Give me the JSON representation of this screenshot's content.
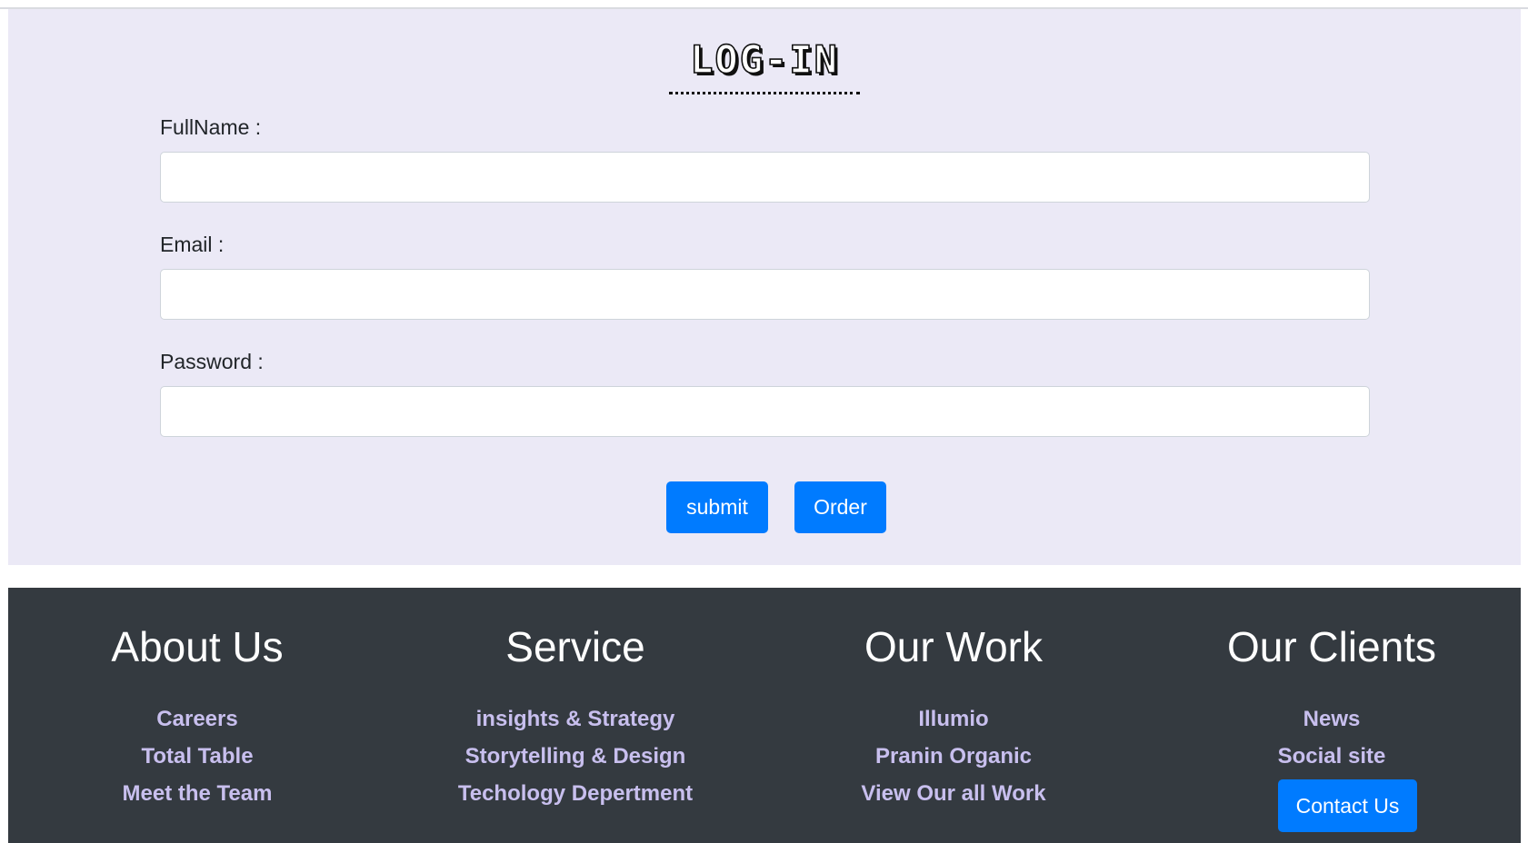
{
  "login": {
    "title": "LOG-IN",
    "fields": [
      {
        "label": "FullName :",
        "value": ""
      },
      {
        "label": "Email :",
        "value": ""
      },
      {
        "label": "Password :",
        "value": ""
      }
    ],
    "submit_label": "submit",
    "order_label": "Order"
  },
  "footer": {
    "columns": [
      {
        "heading": "About Us",
        "links": [
          "Careers",
          "Total Table",
          "Meet the Team"
        ]
      },
      {
        "heading": "Service",
        "links": [
          "insights & Strategy",
          "Storytelling & Design",
          "Techology Depertment"
        ]
      },
      {
        "heading": "Our Work",
        "links": [
          "Illumio",
          "Pranin Organic",
          "View Our all Work"
        ]
      },
      {
        "heading": "Our Clients",
        "links": [
          "News",
          "Social site"
        ]
      }
    ],
    "contact_label": "Contact Us"
  },
  "colors": {
    "login_background": "#ebe9f6",
    "footer_background": "#343a40",
    "button_primary": "#007bff",
    "footer_link": "#c8bfee"
  }
}
